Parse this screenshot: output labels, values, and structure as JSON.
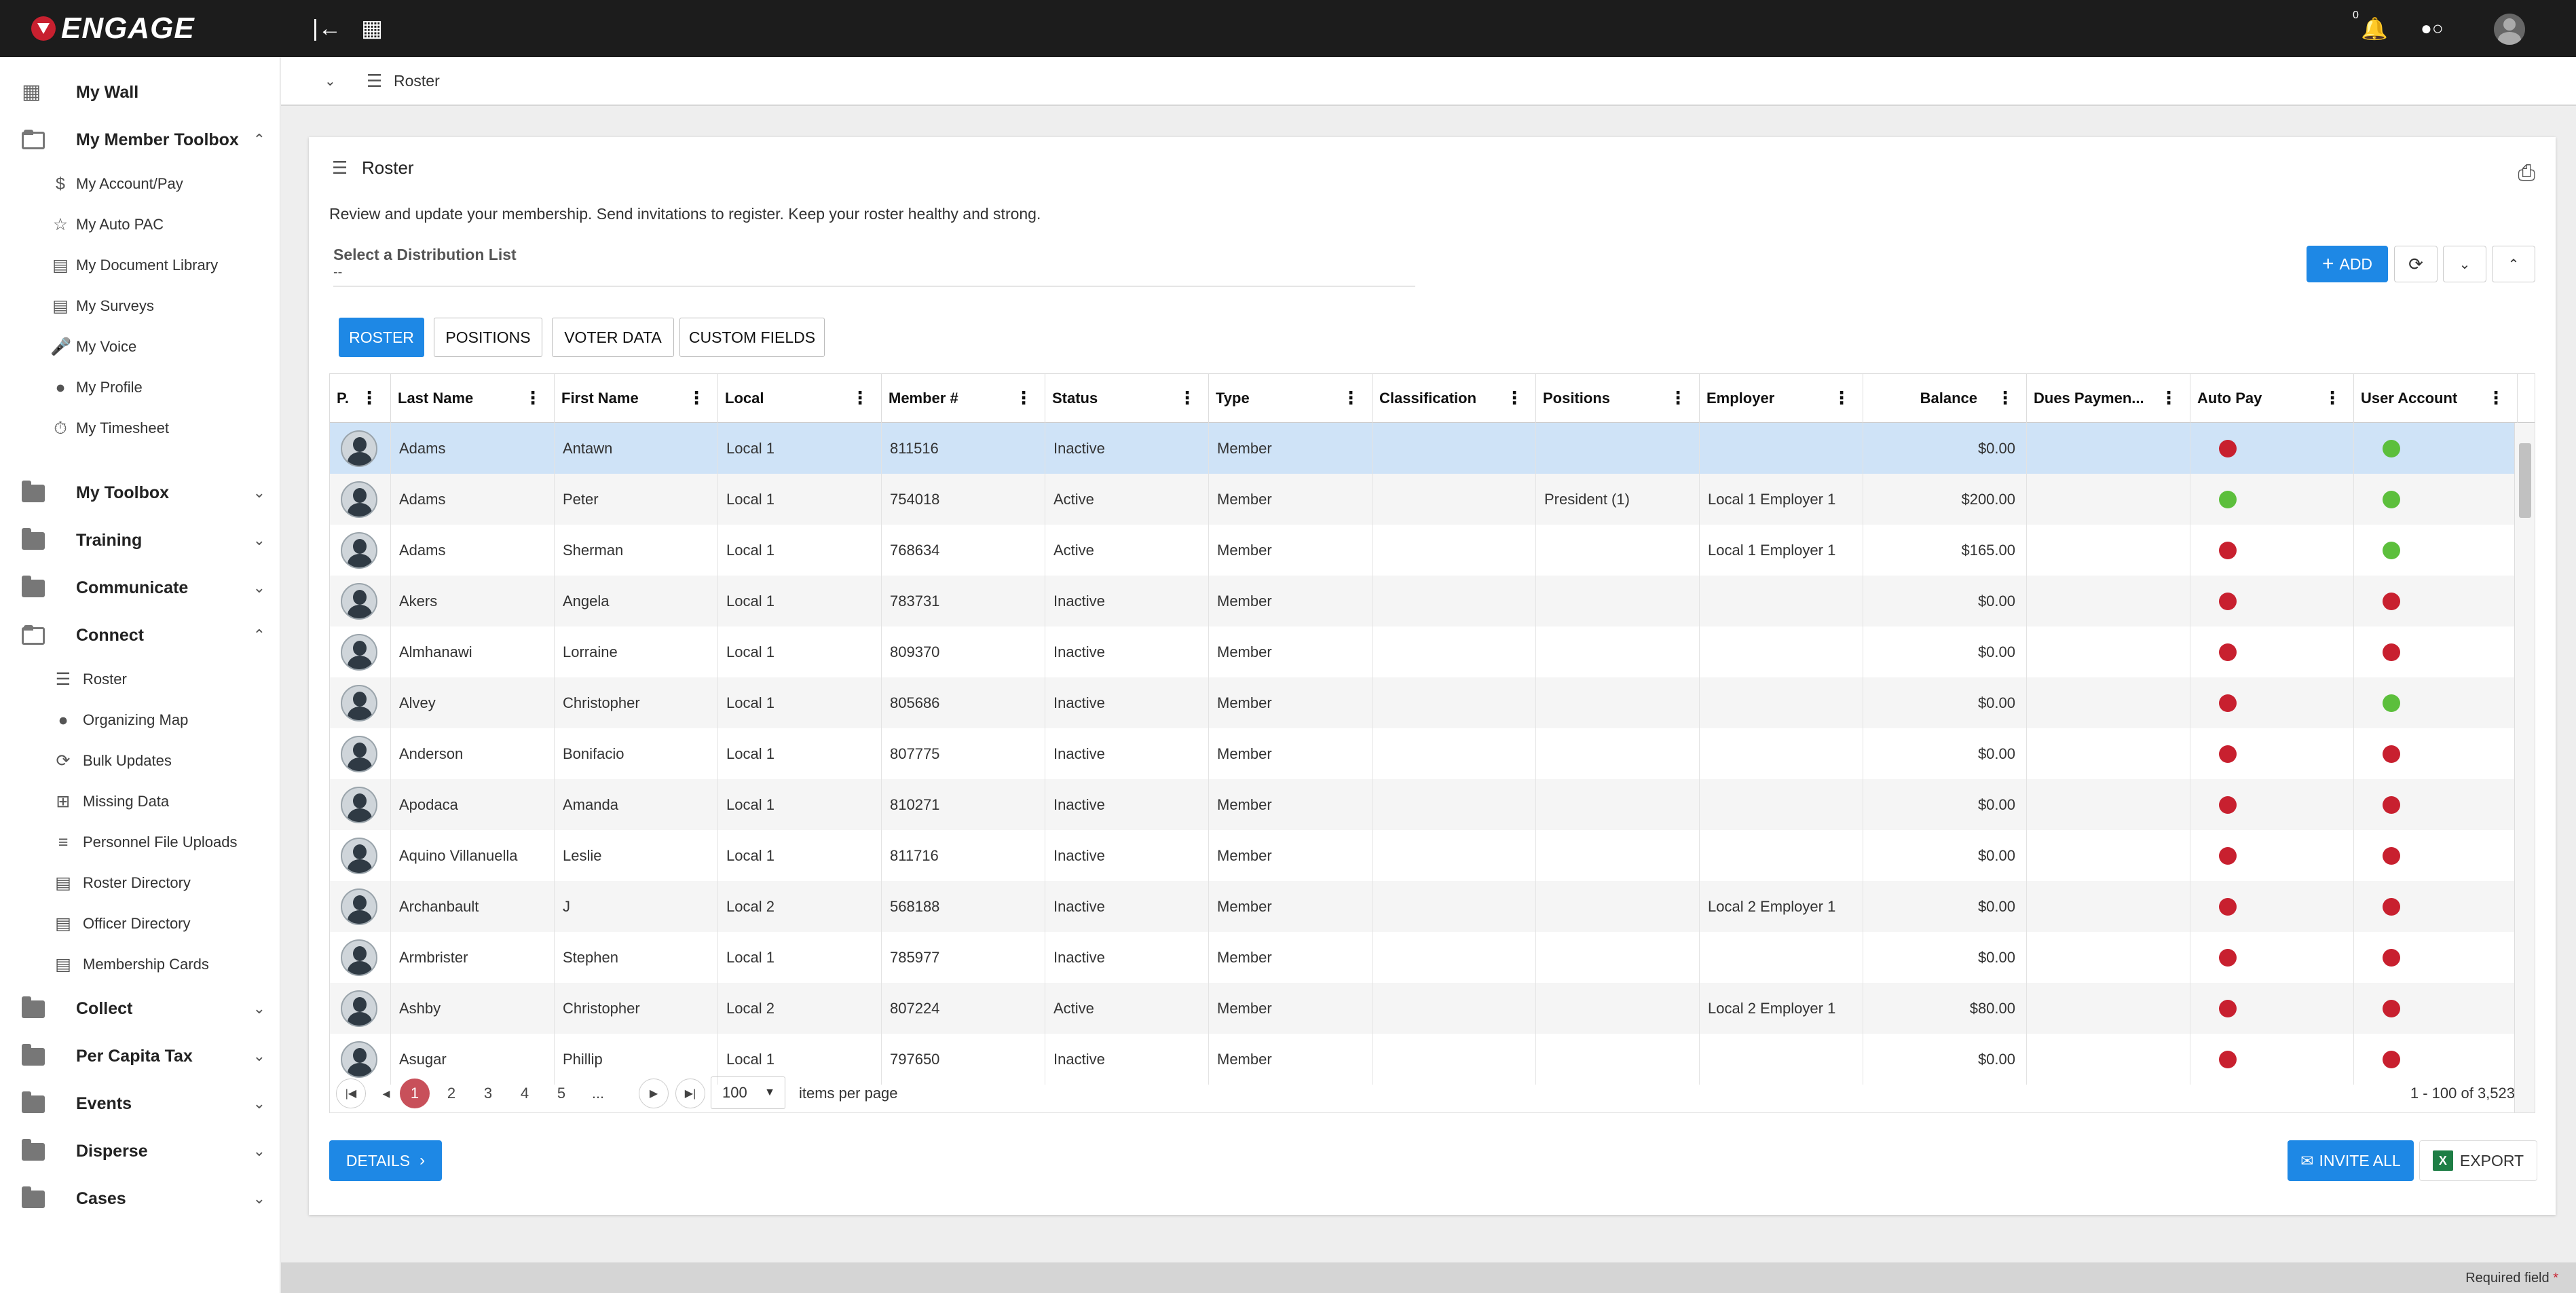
{
  "app": {
    "logo": "ENGAGE",
    "notif_count": "0"
  },
  "breadcrumb": {
    "label": "Roster"
  },
  "sidebar": {
    "items": [
      {
        "label": "My Wall",
        "level": 1,
        "icon": "dashboard-icon",
        "y": 0
      },
      {
        "label": "My Member Toolbox",
        "level": 1,
        "icon": "folder-open-icon",
        "chev": "up"
      },
      {
        "label": "My Account/Pay",
        "level": 2,
        "icon": "dollar-icon"
      },
      {
        "label": "My Auto PAC",
        "level": 2,
        "icon": "star-icon"
      },
      {
        "label": "My Document Library",
        "level": 2,
        "icon": "library-icon"
      },
      {
        "label": "My Surveys",
        "level": 2,
        "icon": "clipboard-icon"
      },
      {
        "label": "My Voice",
        "level": 2,
        "icon": "mic-icon"
      },
      {
        "label": "My Profile",
        "level": 2,
        "icon": "person-icon"
      },
      {
        "label": "My Timesheet",
        "level": 2,
        "icon": "timer-icon"
      },
      {
        "label": "My Toolbox",
        "level": 1,
        "icon": "folder-icon",
        "chev": "down"
      },
      {
        "label": "Training",
        "level": 1,
        "icon": "folder-icon",
        "chev": "down"
      },
      {
        "label": "Communicate",
        "level": 1,
        "icon": "folder-icon",
        "chev": "down"
      },
      {
        "label": "Connect",
        "level": 1,
        "icon": "folder-open-icon",
        "chev": "up"
      },
      {
        "label": "Roster",
        "level": 2,
        "icon": "list-icon"
      },
      {
        "label": "Organizing Map",
        "level": 2,
        "icon": "map-icon"
      },
      {
        "label": "Bulk Updates",
        "level": 2,
        "icon": "sync-icon"
      },
      {
        "label": "Missing Data",
        "level": 2,
        "icon": "plus-box-icon"
      },
      {
        "label": "Personnel File Uploads",
        "level": 2,
        "icon": "numbered-list-icon"
      },
      {
        "label": "Roster Directory",
        "level": 2,
        "icon": "library-icon"
      },
      {
        "label": "Officer Directory",
        "level": 2,
        "icon": "library-icon"
      },
      {
        "label": "Membership Cards",
        "level": 2,
        "icon": "id-card-icon"
      },
      {
        "label": "Collect",
        "level": 1,
        "icon": "folder-icon",
        "chev": "down"
      },
      {
        "label": "Per Capita Tax",
        "level": 1,
        "icon": "folder-icon",
        "chev": "down"
      },
      {
        "label": "Events",
        "level": 1,
        "icon": "folder-icon",
        "chev": "down"
      },
      {
        "label": "Disperse",
        "level": 1,
        "icon": "folder-icon",
        "chev": "down"
      },
      {
        "label": "Cases",
        "level": 1,
        "icon": "folder-icon",
        "chev": "down"
      }
    ]
  },
  "card": {
    "title": "Roster",
    "description": "Review and update your membership. Send invitations to register. Keep your roster healthy and strong.",
    "distribution_label": "Select a Distribution List",
    "distribution_value": "--",
    "add_label": "ADD",
    "tabs": [
      "ROSTER",
      "POSITIONS",
      "VOTER DATA",
      "CUSTOM FIELDS"
    ],
    "details_label": "DETAILS",
    "invite_label": "INVITE ALL",
    "export_label": "EXPORT"
  },
  "grid": {
    "columns": [
      "P.",
      "Last Name",
      "First Name",
      "Local",
      "Member #",
      "Status",
      "Type",
      "Classification",
      "Positions",
      "Employer",
      "Balance",
      "Dues Paymen...",
      "Auto Pay",
      "User Account"
    ],
    "rows": [
      {
        "last": "Adams",
        "first": "Antawn",
        "local": "Local 1",
        "member": "811516",
        "status": "Inactive",
        "type": "Member",
        "classification": "",
        "positions": "",
        "employer": "",
        "balance": "$0.00",
        "dues": "",
        "autopay": "red",
        "account": "green"
      },
      {
        "last": "Adams",
        "first": "Peter",
        "local": "Local 1",
        "member": "754018",
        "status": "Active",
        "type": "Member",
        "classification": "",
        "positions": "President (1)",
        "employer": "Local 1 Employer 1",
        "balance": "$200.00",
        "dues": "",
        "autopay": "green",
        "account": "green"
      },
      {
        "last": "Adams",
        "first": "Sherman",
        "local": "Local 1",
        "member": "768634",
        "status": "Active",
        "type": "Member",
        "classification": "",
        "positions": "",
        "employer": "Local 1 Employer 1",
        "balance": "$165.00",
        "dues": "",
        "autopay": "red",
        "account": "green"
      },
      {
        "last": "Akers",
        "first": "Angela",
        "local": "Local 1",
        "member": "783731",
        "status": "Inactive",
        "type": "Member",
        "classification": "",
        "positions": "",
        "employer": "",
        "balance": "$0.00",
        "dues": "",
        "autopay": "red",
        "account": "red"
      },
      {
        "last": "Almhanawi",
        "first": "Lorraine",
        "local": "Local 1",
        "member": "809370",
        "status": "Inactive",
        "type": "Member",
        "classification": "",
        "positions": "",
        "employer": "",
        "balance": "$0.00",
        "dues": "",
        "autopay": "red",
        "account": "red"
      },
      {
        "last": "Alvey",
        "first": "Christopher",
        "local": "Local 1",
        "member": "805686",
        "status": "Inactive",
        "type": "Member",
        "classification": "",
        "positions": "",
        "employer": "",
        "balance": "$0.00",
        "dues": "",
        "autopay": "red",
        "account": "green"
      },
      {
        "last": "Anderson",
        "first": "Bonifacio",
        "local": "Local 1",
        "member": "807775",
        "status": "Inactive",
        "type": "Member",
        "classification": "",
        "positions": "",
        "employer": "",
        "balance": "$0.00",
        "dues": "",
        "autopay": "red",
        "account": "red"
      },
      {
        "last": "Apodaca",
        "first": "Amanda",
        "local": "Local 1",
        "member": "810271",
        "status": "Inactive",
        "type": "Member",
        "classification": "",
        "positions": "",
        "employer": "",
        "balance": "$0.00",
        "dues": "",
        "autopay": "red",
        "account": "red"
      },
      {
        "last": "Aquino Villanuella",
        "first": "Leslie",
        "local": "Local 1",
        "member": "811716",
        "status": "Inactive",
        "type": "Member",
        "classification": "",
        "positions": "",
        "employer": "",
        "balance": "$0.00",
        "dues": "",
        "autopay": "red",
        "account": "red"
      },
      {
        "last": "Archanbault",
        "first": "J",
        "local": "Local 2",
        "member": "568188",
        "status": "Inactive",
        "type": "Member",
        "classification": "",
        "positions": "",
        "employer": "Local 2 Employer 1",
        "balance": "$0.00",
        "dues": "",
        "autopay": "red",
        "account": "red"
      },
      {
        "last": "Armbrister",
        "first": "Stephen",
        "local": "Local 1",
        "member": "785977",
        "status": "Inactive",
        "type": "Member",
        "classification": "",
        "positions": "",
        "employer": "",
        "balance": "$0.00",
        "dues": "",
        "autopay": "red",
        "account": "red"
      },
      {
        "last": "Ashby",
        "first": "Christopher",
        "local": "Local 2",
        "member": "807224",
        "status": "Active",
        "type": "Member",
        "classification": "",
        "positions": "",
        "employer": "Local 2 Employer 1",
        "balance": "$80.00",
        "dues": "",
        "autopay": "red",
        "account": "red"
      },
      {
        "last": "Asugar",
        "first": "Phillip",
        "local": "Local 1",
        "member": "797650",
        "status": "Inactive",
        "type": "Member",
        "classification": "",
        "positions": "",
        "employer": "",
        "balance": "$0.00",
        "dues": "",
        "autopay": "red",
        "account": "red"
      }
    ]
  },
  "pager": {
    "pages": [
      "1",
      "2",
      "3",
      "4",
      "5",
      "..."
    ],
    "current": "1",
    "page_size": "100",
    "items_label": "items per page",
    "range": "1 - 100 of 3,523"
  },
  "footer": {
    "required": "Required field",
    "required_mark": "*"
  },
  "colors": {
    "accent": "#1e88e5",
    "red": "#c8202f",
    "green": "#5cbf3c",
    "selected_row": "#cfe3f7"
  }
}
